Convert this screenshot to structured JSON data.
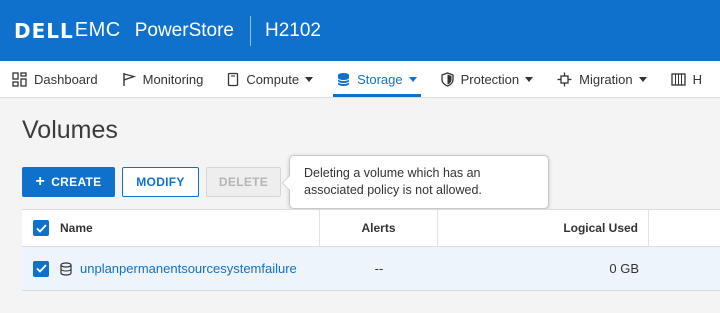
{
  "brand": {
    "company_dell": "DELL",
    "company_emc": "EMC",
    "product": "PowerStore",
    "system": "H2102"
  },
  "nav": {
    "items": [
      {
        "label": "Dashboard",
        "icon": "dashboard-grid-icon",
        "caret": false
      },
      {
        "label": "Monitoring",
        "icon": "flag-icon",
        "caret": false
      },
      {
        "label": "Compute",
        "icon": "server-icon",
        "caret": true
      },
      {
        "label": "Storage",
        "icon": "database-icon",
        "caret": true,
        "active": true
      },
      {
        "label": "Protection",
        "icon": "shield-icon",
        "caret": true
      },
      {
        "label": "Migration",
        "icon": "migration-icon",
        "caret": true
      },
      {
        "label": "H",
        "icon": "hardware-icon",
        "caret": false
      }
    ]
  },
  "page": {
    "title": "Volumes"
  },
  "toolbar": {
    "create_label": "CREATE",
    "modify_label": "MODIFY",
    "delete_label": "DELETE"
  },
  "tooltip": {
    "text": "Deleting a volume which has an associated policy is not allowed."
  },
  "table": {
    "columns": [
      "Name",
      "Alerts",
      "Logical Used"
    ],
    "rows": [
      {
        "name": "unplanpermanentsourcesystemfailure",
        "alerts": "--",
        "logical_used": "0 GB",
        "selected": true
      }
    ]
  },
  "colors": {
    "brand_blue": "#0f71cc",
    "row_selected_bg": "#eef4fb"
  }
}
